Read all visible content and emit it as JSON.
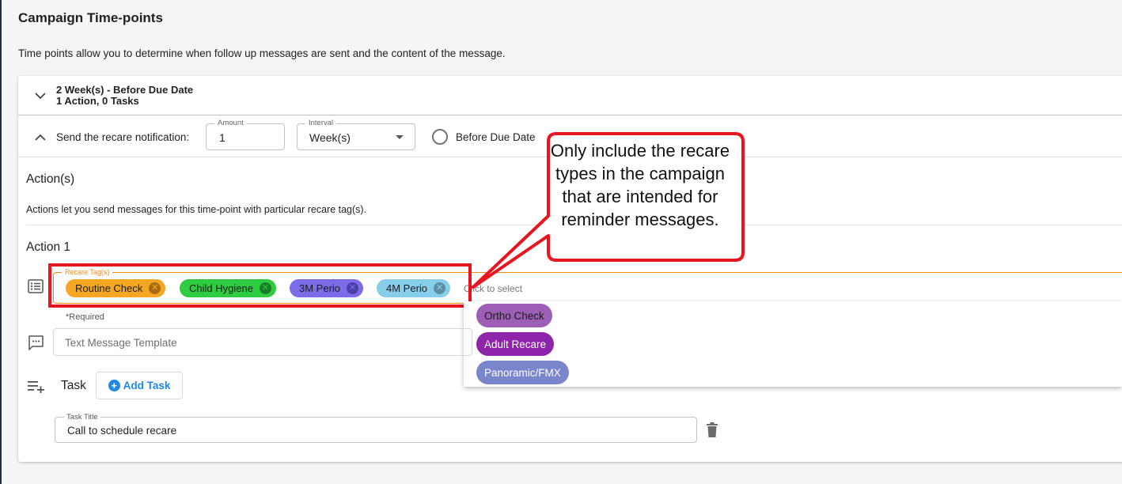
{
  "page": {
    "title": "Campaign Time-points",
    "description": "Time points allow you to determine when follow up messages are sent and the content of the message."
  },
  "timepoint": {
    "title": "2 Week(s) - Before Due Date",
    "subtitle": "1 Action, 0 Tasks"
  },
  "send_row": {
    "label": "Send the recare notification:",
    "amount_label": "Amount",
    "amount_value": "1",
    "interval_label": "Interval",
    "interval_value": "Week(s)",
    "radio_label": "Before Due Date"
  },
  "actions": {
    "heading": "Action(s)",
    "description": "Actions let you send messages for this time-point with particular recare tag(s).",
    "action_title": "Action 1"
  },
  "recare_tags": {
    "legend": "Recare Tag(s)",
    "chips": [
      {
        "label": "Routine Check",
        "color": "#f5a623"
      },
      {
        "label": "Child Hygiene",
        "color": "#2ecc40"
      },
      {
        "label": "3M Perio",
        "color": "#7b6ce8"
      },
      {
        "label": "4M Perio",
        "color": "#87ceeb"
      }
    ],
    "placeholder": "Click to select",
    "required_text": "*Required",
    "options": [
      {
        "label": "Ortho Check",
        "color": "#9c5fb5"
      },
      {
        "label": "Adult Recare",
        "color": "#8e24aa"
      },
      {
        "label": "Panoramic/FMX",
        "color": "#7986cb"
      }
    ]
  },
  "template": {
    "placeholder": "Text Message Template"
  },
  "task": {
    "label": "Task",
    "add_button": "Add Task",
    "title_legend": "Task Title",
    "title_value": "Call to schedule recare"
  },
  "callout": {
    "text": "Only include the recare types in the campaign that are intended for reminder messages."
  },
  "colors": {
    "accent_orange": "#ef8a17",
    "annotation_red": "#e8141e",
    "link_blue": "#1e88e5"
  }
}
